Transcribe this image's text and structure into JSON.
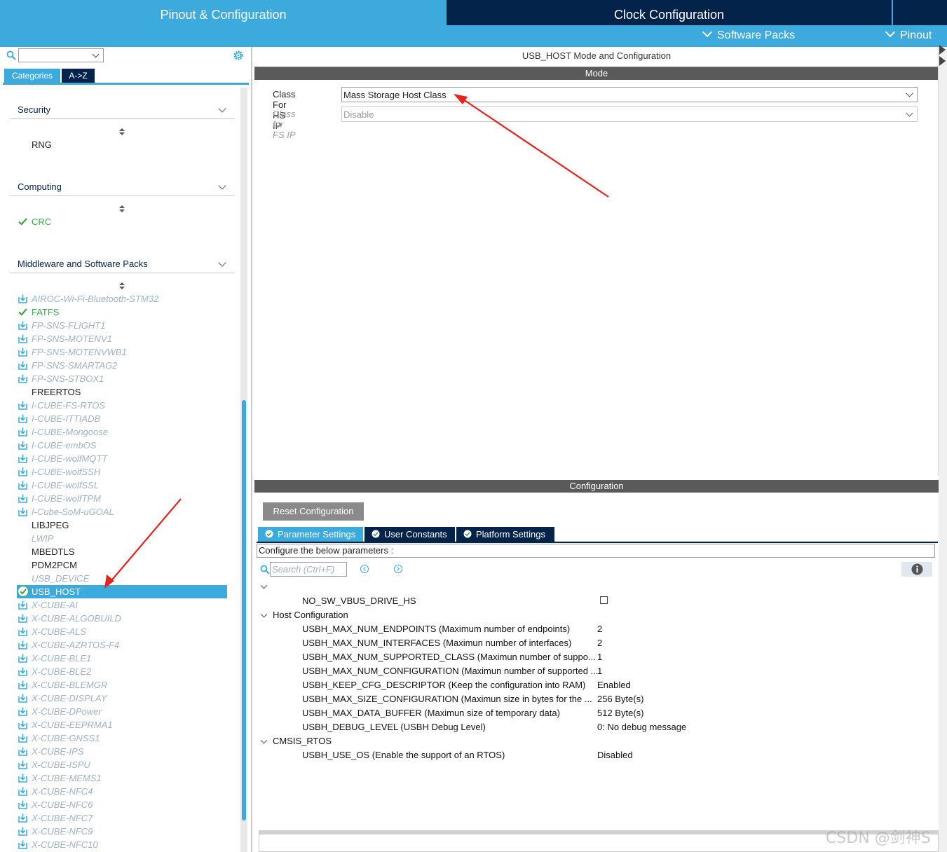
{
  "top_tabs": {
    "pinout_config": "Pinout & Configuration",
    "clock_config": "Clock Configuration",
    "software_packs": "Software Packs",
    "pinout": "Pinout"
  },
  "left_panel": {
    "tabs": {
      "categories": "Categories",
      "a_to_z": "A->Z"
    },
    "category_select_value": "",
    "sections": {
      "security": {
        "title": "Security",
        "items": [
          {
            "label": "RNG",
            "state": "plain"
          }
        ]
      },
      "computing": {
        "title": "Computing",
        "items": [
          {
            "label": "CRC",
            "state": "checked"
          }
        ]
      },
      "middleware": {
        "title": "Middleware and Software Packs",
        "items": [
          {
            "label": "AIROC-Wi-Fi-Bluetooth-STM32",
            "state": "disabled-pack"
          },
          {
            "label": "FATFS",
            "state": "checked"
          },
          {
            "label": "FP-SNS-FLIGHT1",
            "state": "disabled-pack"
          },
          {
            "label": "FP-SNS-MOTENV1",
            "state": "disabled-pack"
          },
          {
            "label": "FP-SNS-MOTENVWB1",
            "state": "disabled-pack"
          },
          {
            "label": "FP-SNS-SMARTAG2",
            "state": "disabled-pack"
          },
          {
            "label": "FP-SNS-STBOX1",
            "state": "disabled-pack"
          },
          {
            "label": "FREERTOS",
            "state": "plain"
          },
          {
            "label": "I-CUBE-FS-RTOS",
            "state": "disabled-pack"
          },
          {
            "label": "I-CUBE-ITTIADB",
            "state": "disabled-pack"
          },
          {
            "label": "I-CUBE-Mongoose",
            "state": "disabled-pack"
          },
          {
            "label": "I-CUBE-embOS",
            "state": "disabled-pack"
          },
          {
            "label": "I-CUBE-wolfMQTT",
            "state": "disabled-pack"
          },
          {
            "label": "I-CUBE-wolfSSH",
            "state": "disabled-pack"
          },
          {
            "label": "I-CUBE-wolfSSL",
            "state": "disabled-pack"
          },
          {
            "label": "I-CUBE-wolfTPM",
            "state": "disabled-pack"
          },
          {
            "label": "I-Cube-SoM-uGOAL",
            "state": "disabled-pack"
          },
          {
            "label": "LIBJPEG",
            "state": "plain"
          },
          {
            "label": "LWIP",
            "state": "disabled"
          },
          {
            "label": "MBEDTLS",
            "state": "plain"
          },
          {
            "label": "PDM2PCM",
            "state": "plain"
          },
          {
            "label": "USB_DEVICE",
            "state": "disabled"
          },
          {
            "label": "USB_HOST",
            "state": "selected"
          },
          {
            "label": "X-CUBE-AI",
            "state": "disabled-pack"
          },
          {
            "label": "X-CUBE-ALGOBUILD",
            "state": "disabled-pack"
          },
          {
            "label": "X-CUBE-ALS",
            "state": "disabled-pack"
          },
          {
            "label": "X-CUBE-AZRTOS-F4",
            "state": "disabled-pack"
          },
          {
            "label": "X-CUBE-BLE1",
            "state": "disabled-pack"
          },
          {
            "label": "X-CUBE-BLE2",
            "state": "disabled-pack"
          },
          {
            "label": "X-CUBE-BLEMGR",
            "state": "disabled-pack"
          },
          {
            "label": "X-CUBE-DISPLAY",
            "state": "disabled-pack"
          },
          {
            "label": "X-CUBE-DPower",
            "state": "disabled-pack"
          },
          {
            "label": "X-CUBE-EEPRMA1",
            "state": "disabled-pack"
          },
          {
            "label": "X-CUBE-GNSS1",
            "state": "disabled-pack"
          },
          {
            "label": "X-CUBE-IPS",
            "state": "disabled-pack"
          },
          {
            "label": "X-CUBE-ISPU",
            "state": "disabled-pack"
          },
          {
            "label": "X-CUBE-MEMS1",
            "state": "disabled-pack"
          },
          {
            "label": "X-CUBE-NFC4",
            "state": "disabled-pack"
          },
          {
            "label": "X-CUBE-NFC6",
            "state": "disabled-pack"
          },
          {
            "label": "X-CUBE-NFC7",
            "state": "disabled-pack"
          },
          {
            "label": "X-CUBE-NFC9",
            "state": "disabled-pack"
          },
          {
            "label": "X-CUBE-NFC10",
            "state": "disabled-pack"
          }
        ]
      }
    }
  },
  "mode_panel": {
    "title": "USB_HOST Mode and Configuration",
    "mode_header": "Mode",
    "class_hs_label": "Class For HS IP",
    "class_hs_value": "Mass Storage Host Class",
    "class_fs_label": "Class for FS IP",
    "class_fs_value": "Disable"
  },
  "config_panel": {
    "header": "Configuration",
    "reset_label": "Reset Configuration",
    "tabs": {
      "parameter_settings": "Parameter Settings",
      "user_constants": "User Constants",
      "platform_settings": "Platform Settings"
    },
    "caption": "Configure the below parameters :",
    "search_placeholder": "Search (Ctrl+F)",
    "top_param": {
      "name": "NO_SW_VBUS_DRIVE_HS",
      "checked": false
    },
    "groups": [
      {
        "name": "Host Configuration",
        "params": [
          {
            "name": "USBH_MAX_NUM_ENDPOINTS (Maximum number of endpoints)",
            "value": "2"
          },
          {
            "name": "USBH_MAX_NUM_INTERFACES (Maximun number of interfaces)",
            "value": "2"
          },
          {
            "name": "USBH_MAX_NUM_SUPPORTED_CLASS (Maximun number of suppo...",
            "value": "1"
          },
          {
            "name": "USBH_MAX_NUM_CONFIGURATION (Maximun number of supported ...",
            "value": "1"
          },
          {
            "name": "USBH_KEEP_CFG_DESCRIPTOR (Keep the configuration into RAM)",
            "value": "Enabled"
          },
          {
            "name": "USBH_MAX_SIZE_CONFIGURATION (Maximun size in bytes for the ...",
            "value": "256 Byte(s)"
          },
          {
            "name": "USBH_MAX_DATA_BUFFER (Maximun size of temporary data)",
            "value": "512 Byte(s)"
          },
          {
            "name": "USBH_DEBUG_LEVEL (USBH Debug Level)",
            "value": "0: No debug message"
          }
        ]
      },
      {
        "name": "CMSIS_RTOS",
        "params": [
          {
            "name": "USBH_USE_OS (Enable the support of an RTOS)",
            "value": "Disabled"
          }
        ]
      }
    ]
  },
  "watermark": "CSDN @剑神S",
  "colors": {
    "accent": "#3caadd",
    "navy": "#03234b",
    "dark_bar": "#5a5a5a",
    "checked_green": "#3aa64c",
    "disabled_text": "#9fb3c3",
    "annotation_red": "#e8221b"
  }
}
